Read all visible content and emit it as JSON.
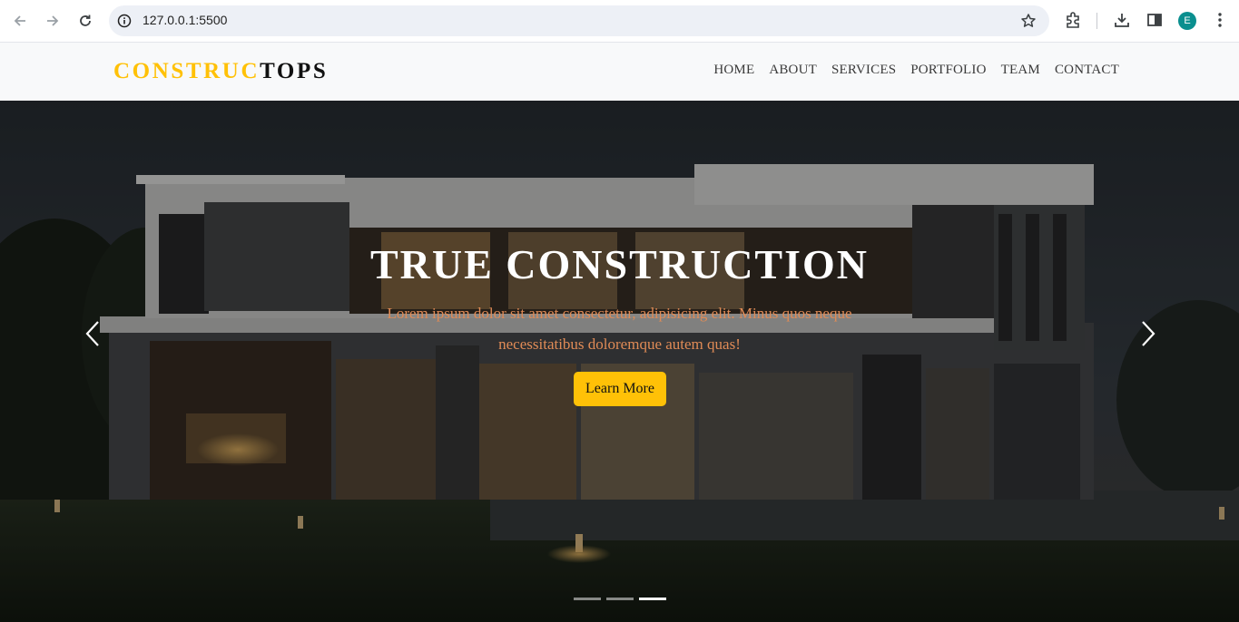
{
  "browser": {
    "url": "127.0.0.1:5500",
    "profile_initial": "E",
    "icons": [
      "back-icon",
      "forward-icon",
      "reload-icon",
      "info-icon",
      "star-icon",
      "extensions-icon",
      "download-icon",
      "side-panel-icon",
      "menu-icon"
    ]
  },
  "site": {
    "brand_accent": "CONSTRUC",
    "brand_rest": "TOPS",
    "accent_color": "#ffc107",
    "nav": [
      "HOME",
      "ABOUT",
      "SERVICES",
      "PORTFOLIO",
      "TEAM",
      "CONTACT"
    ]
  },
  "hero": {
    "title": "TRUE CONSTRUCTION",
    "text": "Lorem ipsum dolor sit amet consectetur, adipisicing elit. Minus quos neque necessitatibus doloremque autem quas!",
    "button": "Learn More",
    "text_color": "#e08b56",
    "slides_count": 3,
    "active_slide": 3
  }
}
